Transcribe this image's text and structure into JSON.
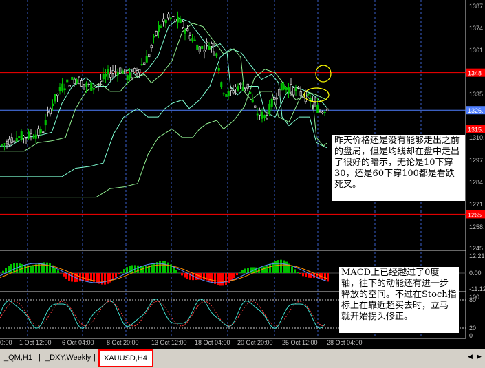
{
  "chart_data": {
    "type": "candlestick",
    "symbol": "XAUUSD",
    "timeframe": "H4",
    "y_ticks": [
      "1387",
      "1374.",
      "1361.",
      "1348",
      "1335",
      "1326.",
      "1310.",
      "1297.",
      "1284.",
      "1271.",
      "1265",
      "1258.",
      "1245."
    ],
    "x_ticks": [
      "0:00",
      "1 Oct 12:00",
      "6 Oct 04:00",
      "8 Oct 20:00",
      "13 Oct 12:00",
      "18 Oct 04:00",
      "20 Oct 20:00",
      "25 Oct 12:00",
      "28 Oct 04:00"
    ],
    "hlines": [
      {
        "value": 1348,
        "label": "1348"
      },
      {
        "value": 1326,
        "label": "1326."
      },
      {
        "value": 1315,
        "label": "1315."
      },
      {
        "value": 1265,
        "label": "1265"
      }
    ],
    "macd": {
      "y_ticks": [
        "12.21",
        "0.00",
        "-11.12"
      ]
    },
    "stoch": {
      "y_ticks": [
        "100",
        "80",
        "20",
        "0"
      ]
    }
  },
  "notes": {
    "main": "昨天价格还是没有能够走出之前的盘局，但是均线却在盘中走出了很好的暗示，无论是10下穿30，还是60下穿100都是看跌死叉。",
    "macd": "MACD上已经越过了0度轴，往下的动能还有进一步释放的空间。不过在Stoch指标上在靠近超买去时，立马就开始拐头修正。"
  },
  "tabs": [
    {
      "label": "_QM,H1",
      "active": false
    },
    {
      "label": "_DXY,Weekly",
      "active": false
    },
    {
      "label": "XAUUSD,H4",
      "active": true
    }
  ],
  "colors": {
    "bull": "#00c000",
    "bear": "#ff0000",
    "grid": "#3a5fcd",
    "hline_red": "#ff0000",
    "hline_blue": "#4f7fff",
    "ma_fast": "#7fffd4",
    "ma_slow": "#90ee90"
  }
}
